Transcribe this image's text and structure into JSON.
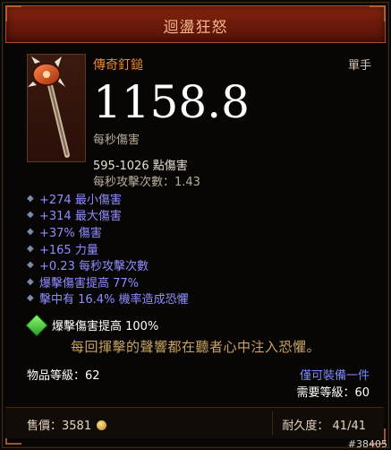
{
  "header": {
    "title": "迴盪狂怒"
  },
  "item": {
    "type": "傳奇釘鎚",
    "hand": "單手",
    "dps": "1158.8",
    "dps_label": "每秒傷害",
    "damage_range": "595-1026 點傷害",
    "attacks_per_second": "每秒攻擊次數：1.43"
  },
  "stats": [
    "+274 最小傷害",
    "+314 最大傷害",
    "+37% 傷害",
    "+165 力量",
    "+0.23 每秒攻擊次數",
    "爆擊傷害提高 77%",
    "擊中有 16.4% 機率造成恐懼"
  ],
  "socket": {
    "gem_icon": "green-gem-icon",
    "text": "爆擊傷害提高 100%"
  },
  "flavor": "每回揮擊的聲響都在聽者心中注入恐懼。",
  "info": {
    "item_level": "物品等級：62",
    "unique_equipped": "僅可裝備一件",
    "required_level": "需要等級：60"
  },
  "footer": {
    "price": "售價：3581",
    "durability": "耐久度： 41/41"
  },
  "tag": "#38405",
  "colors": {
    "header_bg": "#6e1b0b",
    "legendary": "#e9862e",
    "magic_stat": "#8f8dff",
    "flavor": "#c8a464"
  }
}
